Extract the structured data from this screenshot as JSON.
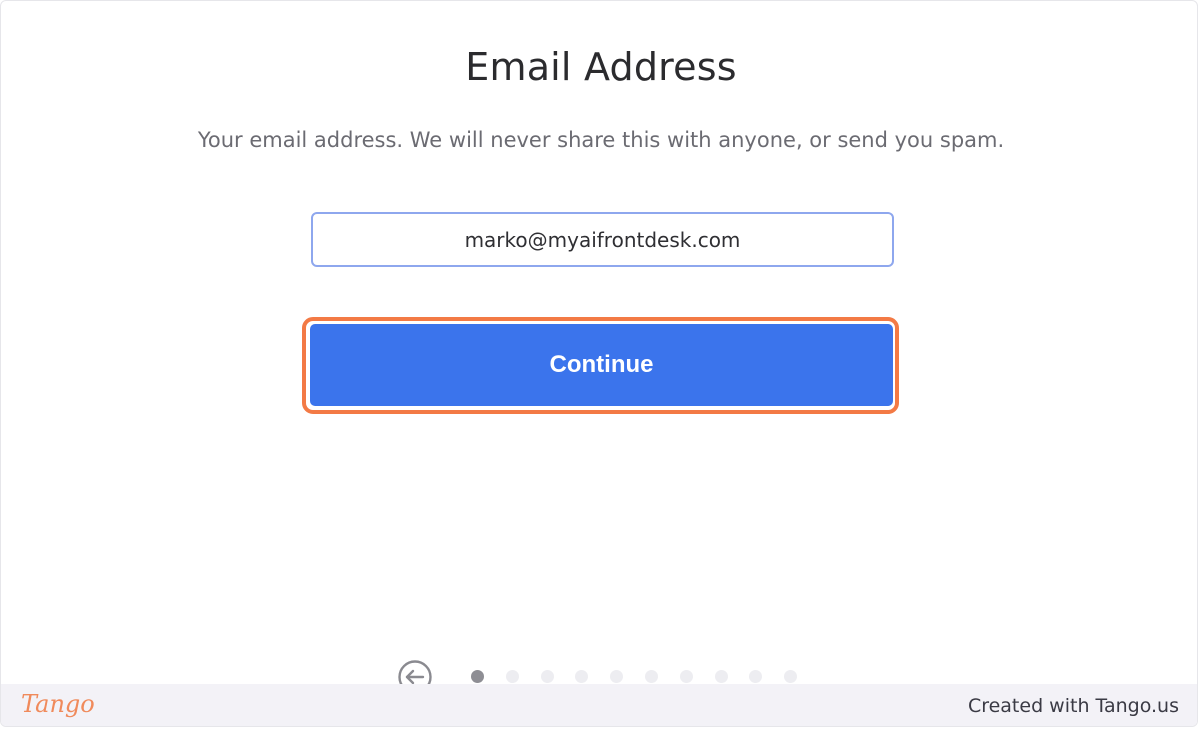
{
  "form": {
    "title": "Email Address",
    "subtitle": "Your email address. We will never share this with anyone, or send you spam.",
    "email_value": "marko@myaifrontdesk.com",
    "continue_label": "Continue"
  },
  "pagination": {
    "total_steps": 10,
    "current_step": 1
  },
  "footer": {
    "logo_text": "Tango",
    "credit_text": "Created with Tango.us"
  },
  "colors": {
    "primary_button": "#3b74ec",
    "highlight_outline": "#f37a45",
    "input_border": "#8ea7ee",
    "brand": "#f08a5b"
  }
}
